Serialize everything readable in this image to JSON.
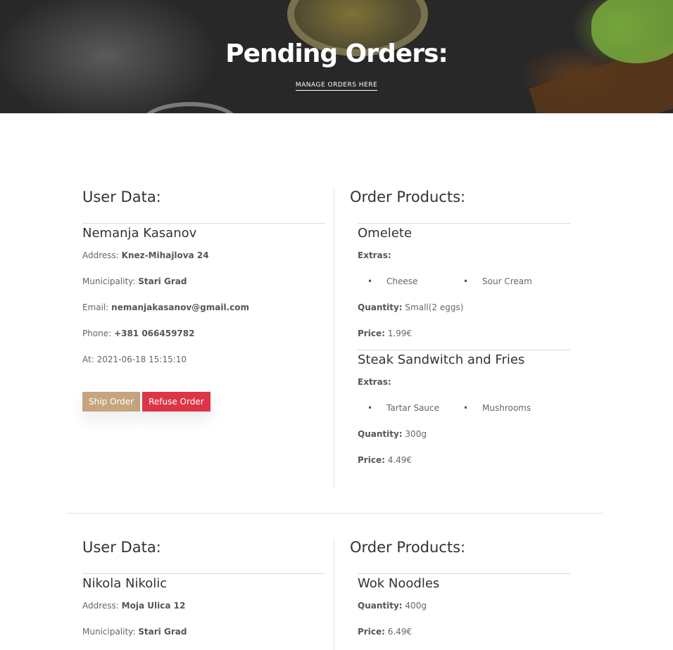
{
  "hero": {
    "title": "Pending Orders:",
    "subtitle": "MANAGE ORDERS HERE"
  },
  "labels": {
    "user_data": "User Data:",
    "order_products": "Order Products:",
    "address": "Address:",
    "municipality": "Municipality:",
    "email": "Email:",
    "phone": "Phone:",
    "at": "At:",
    "extras": "Extras:",
    "quantity": "Quantity:",
    "price": "Price:",
    "ship_button": "Ship Order",
    "refuse_button": "Refuse Order"
  },
  "colors": {
    "ship": "#c5a47e",
    "refuse": "#dc3545"
  },
  "orders": [
    {
      "user": {
        "name": "Nemanja Kasanov",
        "address": "Knez-Mihajlova 24",
        "municipality": "Stari Grad",
        "email": "nemanjakasanov@gmail.com",
        "phone": "+381 066459782",
        "at": "2021-06-18 15:15:10"
      },
      "products": [
        {
          "name": "Omelete",
          "extras": [
            "Cheese",
            "Sour Cream"
          ],
          "quantity": "Small(2 eggs)",
          "price": "1.99€"
        },
        {
          "name": "Steak Sandwitch and Fries",
          "extras": [
            "Tartar Sauce",
            "Mushrooms"
          ],
          "quantity": "300g",
          "price": "4.49€"
        }
      ]
    },
    {
      "user": {
        "name": "Nikola Nikolic",
        "address": "Moja Ulica 12",
        "municipality": "Stari Grad"
      },
      "products": [
        {
          "name": "Wok Noodles",
          "quantity": "400g",
          "price": "6.49€"
        }
      ]
    }
  ]
}
